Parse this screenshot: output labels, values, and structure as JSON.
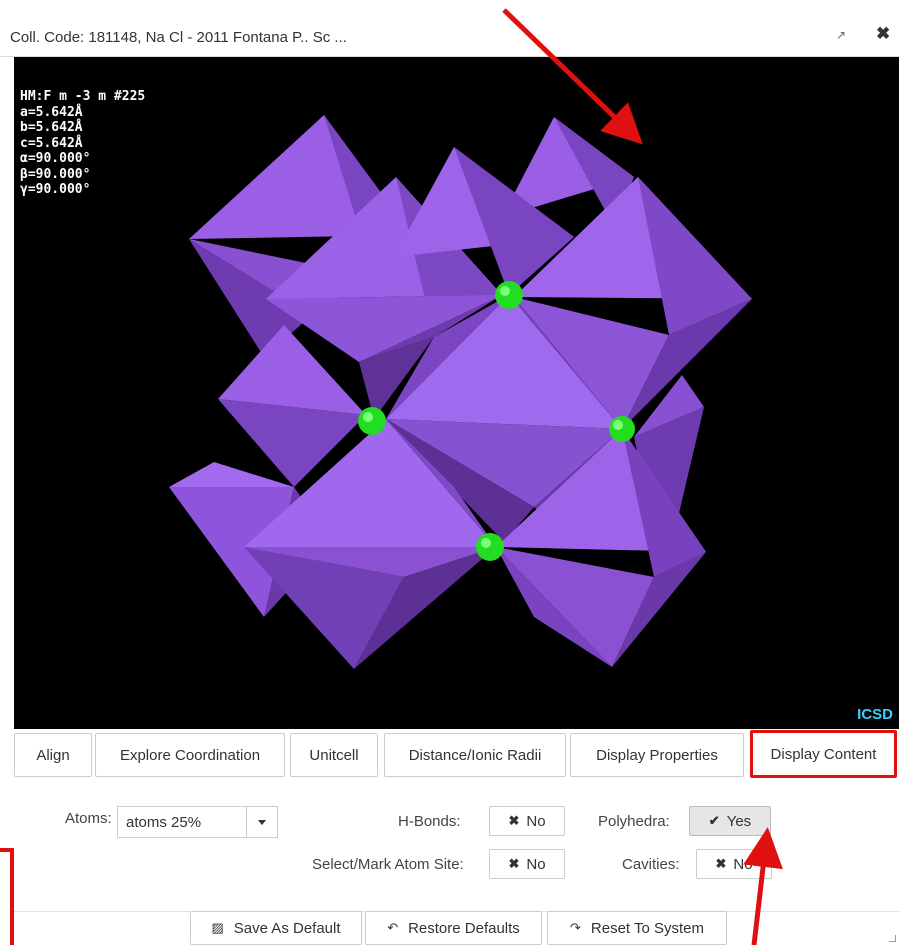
{
  "window": {
    "title": "Coll. Code: 181148, Na Cl - 2011 Fontana P.. Sc ...",
    "popout_icon": "↗",
    "close_icon": "✖"
  },
  "viewer": {
    "cell_info": [
      "HM:F m -3 m #225",
      "a=5.642Å",
      "b=5.642Å",
      "c=5.642Å",
      "α=90.000°",
      "β=90.000°",
      "γ=90.000°"
    ],
    "watermark": "ICSD",
    "colors": {
      "polyhedra": "#9a5ae6",
      "atoms": "#22dd22",
      "background": "#000000"
    }
  },
  "tabs": [
    {
      "label": "Align"
    },
    {
      "label": "Explore Coordination"
    },
    {
      "label": "Unitcell"
    },
    {
      "label": "Distance/Ionic Radii"
    },
    {
      "label": "Display Properties"
    },
    {
      "label": "Display Content",
      "active": true
    }
  ],
  "display_content": {
    "atoms_label": "Atoms:",
    "atoms_value": "atoms 25%",
    "hbonds_label": "H-Bonds:",
    "hbonds_value": "No",
    "polyhedra_label": "Polyhedra:",
    "polyhedra_value": "Yes",
    "select_mark_label": "Select/Mark Atom Site:",
    "select_mark_value": "No",
    "cavities_label": "Cavities:",
    "cavities_value": "No"
  },
  "footer": {
    "save_label": "Save As Default",
    "restore_label": "Restore Defaults",
    "reset_label": "Reset To System"
  },
  "accent_color": "#e01010"
}
